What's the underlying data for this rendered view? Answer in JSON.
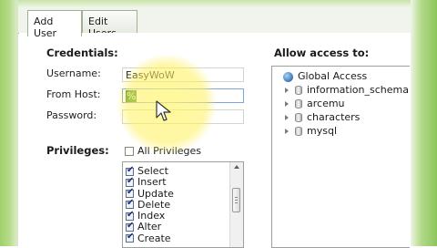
{
  "tabs": [
    {
      "label": "Add User",
      "active": true
    },
    {
      "label": "Edit Users",
      "active": false
    }
  ],
  "credentials": {
    "title": "Credentials:",
    "username_label": "Username:",
    "username_value": "EasyWoW",
    "host_label": "From Host:",
    "host_value": "%",
    "password_label": "Password:",
    "password_value": ""
  },
  "privileges": {
    "title": "Privileges:",
    "all_label": "All Privileges",
    "all_checked": false,
    "items": [
      {
        "label": "Select",
        "checked": true
      },
      {
        "label": "Insert",
        "checked": true
      },
      {
        "label": "Update",
        "checked": true
      },
      {
        "label": "Delete",
        "checked": true
      },
      {
        "label": "Index",
        "checked": true
      },
      {
        "label": "Alter",
        "checked": true
      },
      {
        "label": "Create",
        "checked": true
      }
    ]
  },
  "access": {
    "title": "Allow access to:",
    "root": {
      "label": "Global Access",
      "icon": "globe-icon"
    },
    "databases": [
      {
        "label": "information_schema",
        "icon": "database-icon"
      },
      {
        "label": "arcemu",
        "icon": "database-icon"
      },
      {
        "label": "characters",
        "icon": "database-icon"
      },
      {
        "label": "mysql",
        "icon": "database-icon"
      }
    ]
  },
  "colors": {
    "frame_green": "#8cc65a",
    "highlight_yellow": "#fff05a"
  }
}
